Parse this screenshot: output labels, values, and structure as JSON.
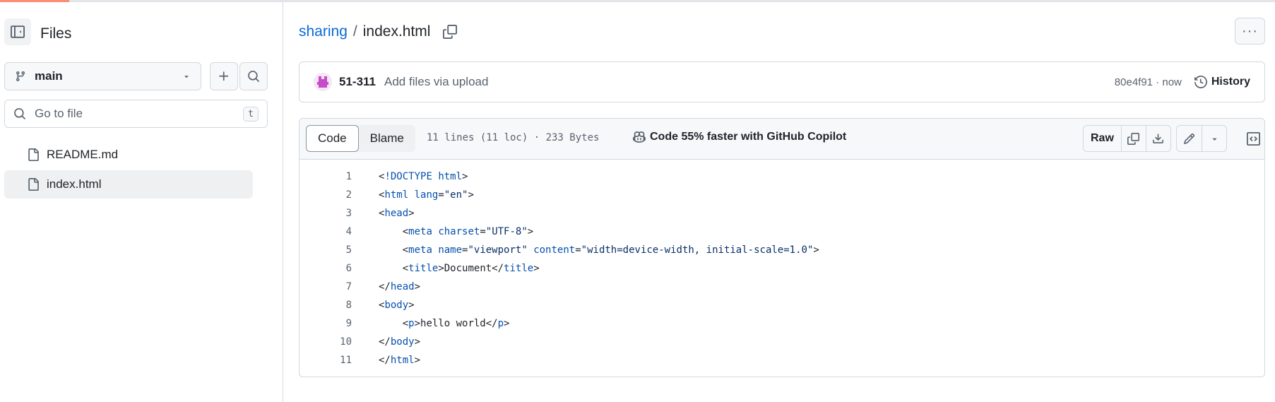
{
  "sidebar": {
    "title": "Files",
    "branch": "main",
    "search_placeholder": "Go to file",
    "search_shortcut": "t",
    "files": [
      {
        "name": "README.md",
        "selected": false
      },
      {
        "name": "index.html",
        "selected": true
      }
    ]
  },
  "header": {
    "repo": "sharing",
    "separator": "/",
    "filename": "index.html"
  },
  "commit": {
    "author": "51-311",
    "message": "Add files via upload",
    "hash_time": "80e4f91 · now",
    "history_label": "History"
  },
  "file": {
    "tabs": [
      "Code",
      "Blame"
    ],
    "active_tab": "Code",
    "meta": "11 lines (11 loc) · 233 Bytes",
    "copilot_text": "Code 55% faster with GitHub Copilot",
    "raw_label": "Raw"
  },
  "code_lines": [
    {
      "n": "1",
      "text": "<!DOCTYPE html>"
    },
    {
      "n": "2",
      "text": "<html lang=\"en\">"
    },
    {
      "n": "3",
      "text": "<head>"
    },
    {
      "n": "4",
      "text": "    <meta charset=\"UTF-8\">"
    },
    {
      "n": "5",
      "text": "    <meta name=\"viewport\" content=\"width=device-width, initial-scale=1.0\">"
    },
    {
      "n": "6",
      "text": "    <title>Document</title>"
    },
    {
      "n": "7",
      "text": "</head>"
    },
    {
      "n": "8",
      "text": "<body>"
    },
    {
      "n": "9",
      "text": "    <p>hello world</p>"
    },
    {
      "n": "10",
      "text": "</body>"
    },
    {
      "n": "11",
      "text": "</html>"
    }
  ],
  "colors": {
    "link": "#0969da",
    "accent_tab": "#fd8c73",
    "border": "#d1d9e0",
    "muted_text": "#59636e",
    "avatar_pink": "#c74ac9"
  }
}
